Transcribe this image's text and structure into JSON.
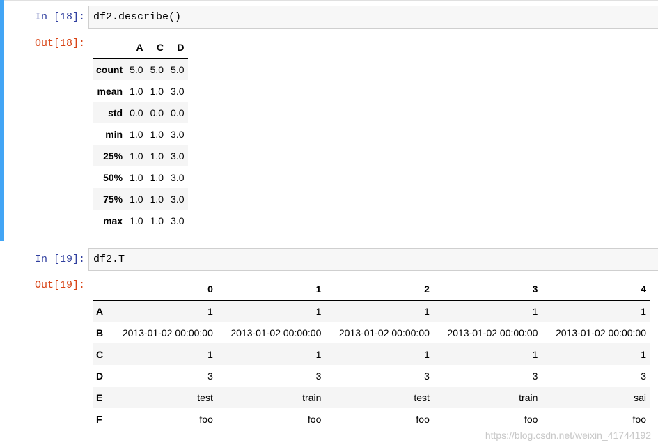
{
  "cells": [
    {
      "in_prompt": "In  [18]:",
      "code": "df2.describe()",
      "out_prompt": "Out[18]:",
      "table": {
        "columns": [
          "A",
          "C",
          "D"
        ],
        "rows": [
          {
            "index": "count",
            "values": [
              "5.0",
              "5.0",
              "5.0"
            ]
          },
          {
            "index": "mean",
            "values": [
              "1.0",
              "1.0",
              "3.0"
            ]
          },
          {
            "index": "std",
            "values": [
              "0.0",
              "0.0",
              "0.0"
            ]
          },
          {
            "index": "min",
            "values": [
              "1.0",
              "1.0",
              "3.0"
            ]
          },
          {
            "index": "25%",
            "values": [
              "1.0",
              "1.0",
              "3.0"
            ]
          },
          {
            "index": "50%",
            "values": [
              "1.0",
              "1.0",
              "3.0"
            ]
          },
          {
            "index": "75%",
            "values": [
              "1.0",
              "1.0",
              "3.0"
            ]
          },
          {
            "index": "max",
            "values": [
              "1.0",
              "1.0",
              "3.0"
            ]
          }
        ]
      }
    },
    {
      "in_prompt": "In  [19]:",
      "code": "df2.T",
      "out_prompt": "Out[19]:",
      "table": {
        "columns": [
          "0",
          "1",
          "2",
          "3",
          "4"
        ],
        "rows": [
          {
            "index": "A",
            "values": [
              "1",
              "1",
              "1",
              "1",
              "1"
            ]
          },
          {
            "index": "B",
            "values": [
              "2013-01-02 00:00:00",
              "2013-01-02 00:00:00",
              "2013-01-02 00:00:00",
              "2013-01-02 00:00:00",
              "2013-01-02 00:00:00"
            ]
          },
          {
            "index": "C",
            "values": [
              "1",
              "1",
              "1",
              "1",
              "1"
            ]
          },
          {
            "index": "D",
            "values": [
              "3",
              "3",
              "3",
              "3",
              "3"
            ]
          },
          {
            "index": "E",
            "values": [
              "test",
              "train",
              "test",
              "train",
              "sai"
            ]
          },
          {
            "index": "F",
            "values": [
              "foo",
              "foo",
              "foo",
              "foo",
              "foo"
            ]
          }
        ]
      }
    }
  ],
  "watermark": "https://blog.csdn.net/weixin_41744192",
  "colors": {
    "selected_cell_bar": "#42a5f5",
    "in_prompt": "#303f9f",
    "out_prompt": "#d84315",
    "input_bg": "#f7f7f7"
  }
}
